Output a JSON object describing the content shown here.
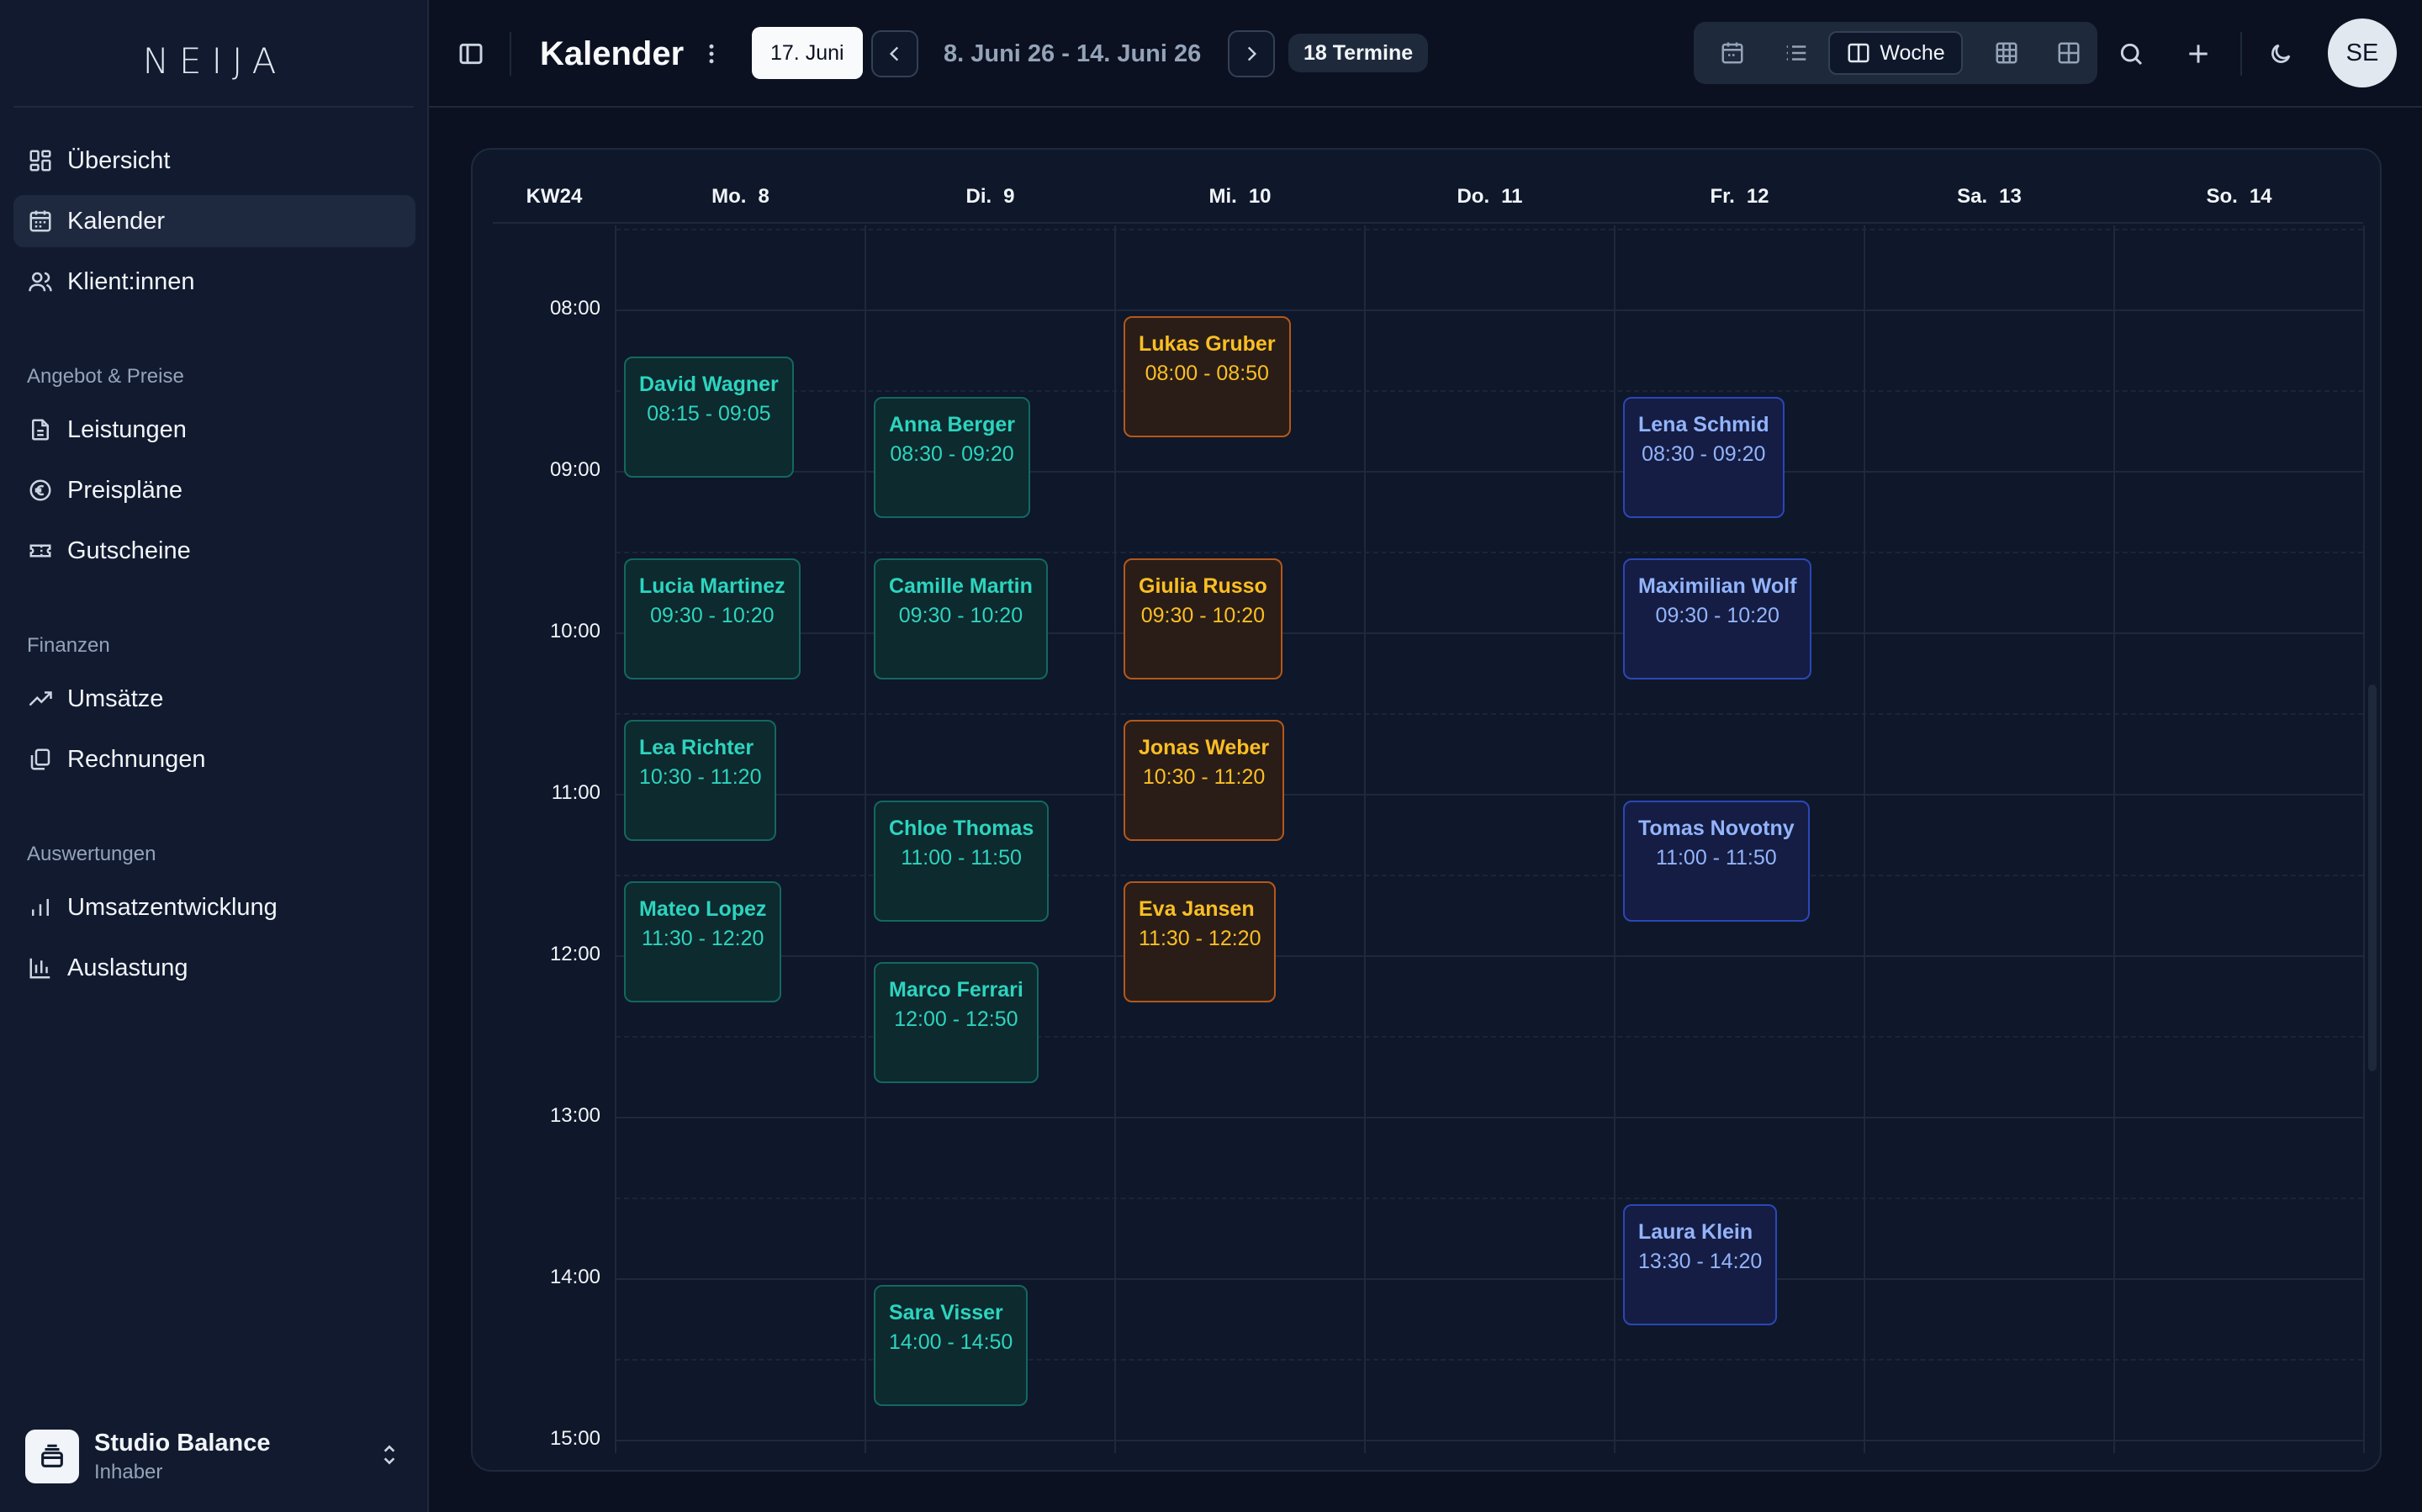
{
  "app": {
    "logo": "NEIJA",
    "nav_top": [
      {
        "label": "Übersicht",
        "icon": "dashboard-icon"
      },
      {
        "label": "Kalender",
        "icon": "calendar-icon",
        "active": true
      },
      {
        "label": "Klient:innen",
        "icon": "users-icon"
      }
    ],
    "sections": [
      {
        "title": "Angebot & Preise",
        "items": [
          {
            "label": "Leistungen",
            "icon": "document-icon"
          },
          {
            "label": "Preispläne",
            "icon": "euro-icon"
          },
          {
            "label": "Gutscheine",
            "icon": "ticket-icon"
          }
        ]
      },
      {
        "title": "Finanzen",
        "items": [
          {
            "label": "Umsätze",
            "icon": "trending-up-icon"
          },
          {
            "label": "Rechnungen",
            "icon": "invoices-icon"
          }
        ]
      },
      {
        "title": "Auswertungen",
        "items": [
          {
            "label": "Umsatzentwicklung",
            "icon": "bar-chart-icon"
          },
          {
            "label": "Auslastung",
            "icon": "utilization-chart-icon"
          }
        ]
      }
    ],
    "studio": {
      "name": "Studio Balance",
      "role": "Inhaber"
    }
  },
  "topbar": {
    "title": "Kalender",
    "today": "17. Juni",
    "range": "8. Juni 26 - 14. Juni 26",
    "count": "18 Termine",
    "views": {
      "active_label": "Woche"
    },
    "avatar": "SE"
  },
  "calendar": {
    "week_label": "KW24",
    "days": [
      {
        "name": "Mo.",
        "num": "8"
      },
      {
        "name": "Di.",
        "num": "9"
      },
      {
        "name": "Mi.",
        "num": "10"
      },
      {
        "name": "Do.",
        "num": "11"
      },
      {
        "name": "Fr.",
        "num": "12"
      },
      {
        "name": "Sa.",
        "num": "13"
      },
      {
        "name": "So.",
        "num": "14"
      }
    ],
    "hours": [
      "08:00",
      "09:00",
      "10:00",
      "11:00",
      "12:00",
      "13:00",
      "14:00",
      "15:00"
    ],
    "colors": {
      "teal": "#2dd4bf",
      "orange": "#fbbf24",
      "blue": "#93b4fb"
    },
    "events": [
      {
        "name": "David Wagner",
        "time": "08:15 - 09:05",
        "day": 0,
        "color": "teal"
      },
      {
        "name": "Lucia Martinez",
        "time": "09:30 - 10:20",
        "day": 0,
        "color": "teal"
      },
      {
        "name": "Lea Richter",
        "time": "10:30 - 11:20",
        "day": 0,
        "color": "teal"
      },
      {
        "name": "Mateo Lopez",
        "time": "11:30 - 12:20",
        "day": 0,
        "color": "teal"
      },
      {
        "name": "Anna Berger",
        "time": "08:30 - 09:20",
        "day": 1,
        "color": "teal"
      },
      {
        "name": "Camille Martin",
        "time": "09:30 - 10:20",
        "day": 1,
        "color": "teal"
      },
      {
        "name": "Chloe Thomas",
        "time": "11:00 - 11:50",
        "day": 1,
        "color": "teal"
      },
      {
        "name": "Marco Ferrari",
        "time": "12:00 - 12:50",
        "day": 1,
        "color": "teal"
      },
      {
        "name": "Sara Visser",
        "time": "14:00 - 14:50",
        "day": 1,
        "color": "teal"
      },
      {
        "name": "Lukas Gruber",
        "time": "08:00 - 08:50",
        "day": 2,
        "color": "orange"
      },
      {
        "name": "Giulia Russo",
        "time": "09:30 - 10:20",
        "day": 2,
        "color": "orange"
      },
      {
        "name": "Jonas Weber",
        "time": "10:30 - 11:20",
        "day": 2,
        "color": "orange"
      },
      {
        "name": "Eva Jansen",
        "time": "11:30 - 12:20",
        "day": 2,
        "color": "orange"
      },
      {
        "name": "Lena Schmid",
        "time": "08:30 - 09:20",
        "day": 4,
        "color": "blue"
      },
      {
        "name": "Maximilian Wolf",
        "time": "09:30 - 10:20",
        "day": 4,
        "color": "blue"
      },
      {
        "name": "Tomas Novotny",
        "time": "11:00 - 11:50",
        "day": 4,
        "color": "blue"
      },
      {
        "name": "Laura Klein",
        "time": "13:30 - 14:20",
        "day": 4,
        "color": "blue"
      }
    ]
  }
}
